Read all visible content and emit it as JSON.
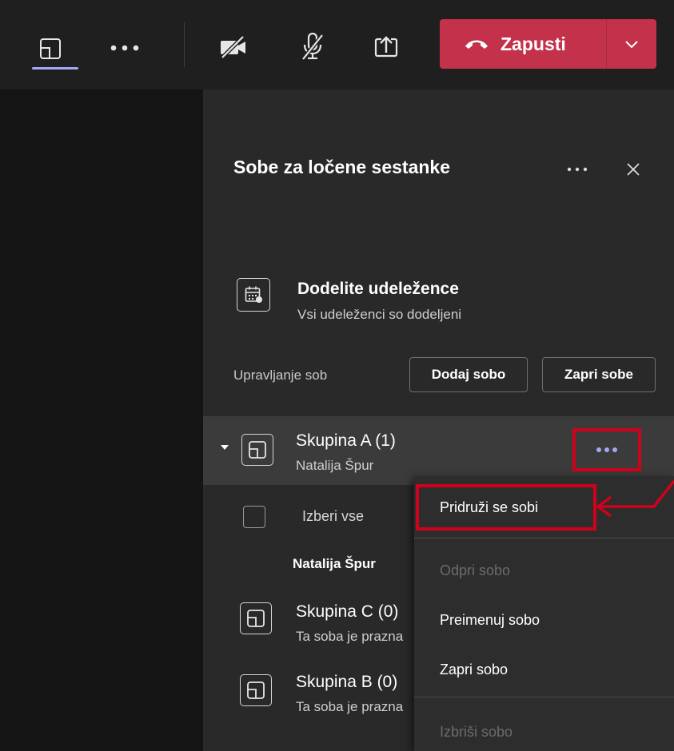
{
  "toolbar": {
    "leave_label": "Zapusti"
  },
  "panel": {
    "title": "Sobe za ločene sestanke",
    "assign": {
      "title": "Dodelite udeležence",
      "subtitle": "Vsi udeleženci so dodeljeni"
    },
    "manage": {
      "label": "Upravljanje sob",
      "add_room_label": "Dodaj sobo",
      "close_rooms_label": "Zapri sobe"
    },
    "rooms": [
      {
        "name": "Skupina A (1)",
        "status": "Natalija Špur"
      },
      {
        "name": "Skupina C (0)",
        "status": "Ta soba je prazna"
      },
      {
        "name": "Skupina B (0)",
        "status": "Ta soba je prazna"
      }
    ],
    "select_all_label": "Izberi vse",
    "participants": [
      "Natalija Špur"
    ]
  },
  "context_menu": {
    "items": [
      {
        "label": "Pridruži se sobi",
        "enabled": true
      },
      {
        "label": "Odpri sobo",
        "enabled": false
      },
      {
        "label": "Preimenuj sobo",
        "enabled": true
      },
      {
        "label": "Zapri sobo",
        "enabled": true
      },
      {
        "label": "Izbriši sobo",
        "enabled": false
      }
    ]
  },
  "colors": {
    "toolbar_bg": "#1f1f1f",
    "stage_bg": "#141414",
    "panel_bg": "#292929",
    "row_selected_bg": "#3b3b3b",
    "leave_button": "#c4314b",
    "accent": "#a5a7f2",
    "annotation_red": "#d0021b"
  },
  "icons": {
    "view": "screen-layout-icon",
    "more": "more-horizontal-icon",
    "camera": "camera-off-icon",
    "mic": "mic-off-icon",
    "share": "share-tray-icon",
    "phone": "phone-hangup-icon",
    "chevron": "chevron-down-icon",
    "close": "close-icon",
    "assign": "calendar-assign-icon",
    "room": "breakout-room-icon",
    "arrow": "red-annotation-arrow-icon"
  }
}
